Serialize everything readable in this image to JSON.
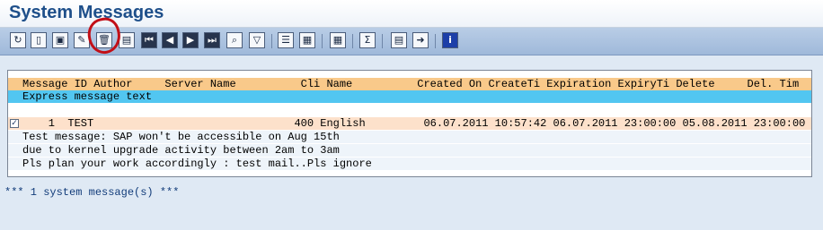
{
  "window": {
    "title": "System Messages"
  },
  "toolbar": {
    "buttons": [
      {
        "name": "refresh",
        "glyph": "↻",
        "tip": "refresh"
      },
      {
        "name": "create",
        "glyph": "▯",
        "tip": "create"
      },
      {
        "name": "save",
        "glyph": "▣",
        "tip": "save"
      },
      {
        "name": "edit",
        "glyph": "✎",
        "tip": "edit"
      },
      {
        "name": "delete",
        "glyph": "🗑",
        "tip": "delete"
      },
      {
        "name": "details",
        "glyph": "▤",
        "tip": "details"
      },
      {
        "name": "first",
        "glyph": "⏮",
        "tip": "first"
      },
      {
        "name": "previous",
        "glyph": "◀",
        "tip": "previous"
      },
      {
        "name": "next",
        "glyph": "▶",
        "tip": "next"
      },
      {
        "name": "last",
        "glyph": "⏭",
        "tip": "last"
      },
      {
        "name": "find",
        "glyph": "⌕",
        "tip": "find"
      },
      {
        "name": "filter",
        "glyph": "▽",
        "tip": "filter"
      },
      {
        "name": "view-list",
        "glyph": "☰",
        "tip": "list"
      },
      {
        "name": "export",
        "glyph": "▦",
        "tip": "export"
      },
      {
        "name": "grid",
        "glyph": "▦",
        "tip": "grid"
      },
      {
        "name": "sum",
        "glyph": "Σ",
        "tip": "sum"
      },
      {
        "name": "print",
        "glyph": "▤",
        "tip": "print"
      },
      {
        "name": "send",
        "glyph": "➜",
        "tip": "send"
      },
      {
        "name": "info",
        "glyph": "i",
        "tip": "info"
      }
    ]
  },
  "list": {
    "header": "Message ID Author     Server Name          Cli Name          Created On CreateTi Expiration ExpiryTi Delete     Del. Tim",
    "subheader": "Express message text",
    "entry": {
      "checkbox": "✓",
      "line": "    1  TEST                               400 English         06.07.2011 10:57:42 06.07.2011 23:00:00 05.08.2011 23:00:00",
      "text_lines": [
        "Test message: SAP won't be accessible on Aug 15th",
        "due to kernel upgrade activity between 2am to 3am",
        "Pls plan your work accordingly : test mail..Pls ignore"
      ]
    }
  },
  "footer": {
    "status": "*** 1 system message(s) ***"
  },
  "colors": {
    "title": "#1e4f8a",
    "header": "#f9c98a",
    "subheader": "#52c6f1",
    "row": "#fde1cb",
    "annotation": "#c20f17"
  }
}
